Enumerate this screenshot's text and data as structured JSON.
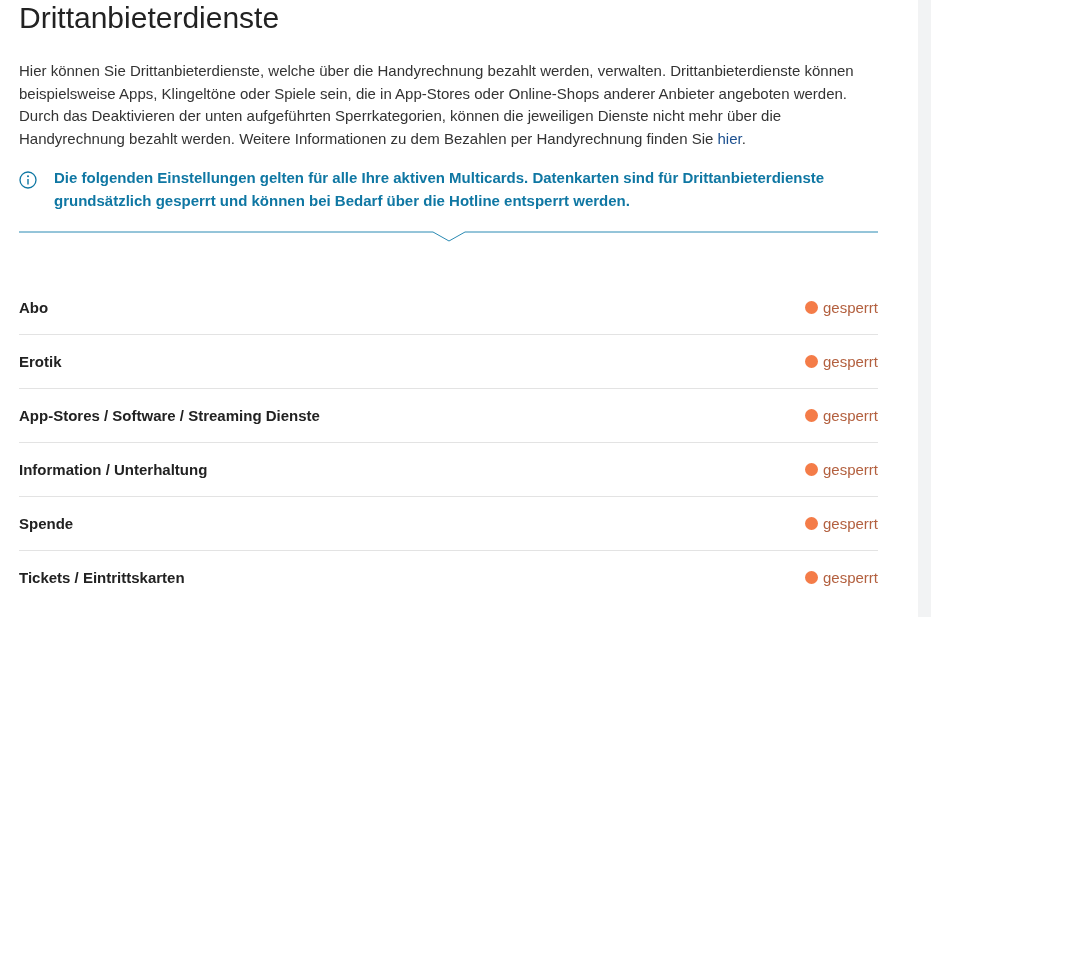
{
  "title": "Drittanbieterdienste",
  "intro": {
    "text": "Hier können Sie Drittanbieterdienste, welche über die Handyrechnung bezahlt werden, verwalten. Drittanbieterdienste können beispielsweise Apps, Klingeltöne oder Spiele sein, die in App-Stores oder Online-Shops anderer Anbieter angeboten werden. Durch das Deaktivieren der unten aufgeführten Sperrkategorien, können die jeweiligen Dienste nicht mehr über die Handyrechnung bezahlt werden. Weitere Informationen zu dem Bezahlen per Handyrechnung finden Sie ",
    "link": "hier",
    "after": "."
  },
  "notice": "Die folgenden Einstellungen gelten für alle Ihre aktiven Multicards. Datenkarten sind für Drittanbieterdienste grundsätzlich gesperrt und können bei Bedarf über die Hotline entsperrt werden.",
  "categories": [
    {
      "name": "Abo",
      "status": "gesperrt",
      "color": "#f47c48"
    },
    {
      "name": "Erotik",
      "status": "gesperrt",
      "color": "#f47c48"
    },
    {
      "name": "App-Stores / Software / Streaming Dienste",
      "status": "gesperrt",
      "color": "#f47c48"
    },
    {
      "name": "Information / Unterhaltung",
      "status": "gesperrt",
      "color": "#f47c48"
    },
    {
      "name": "Spende",
      "status": "gesperrt",
      "color": "#f47c48"
    },
    {
      "name": "Tickets / Eintrittskarten",
      "status": "gesperrt",
      "color": "#f47c48"
    }
  ]
}
